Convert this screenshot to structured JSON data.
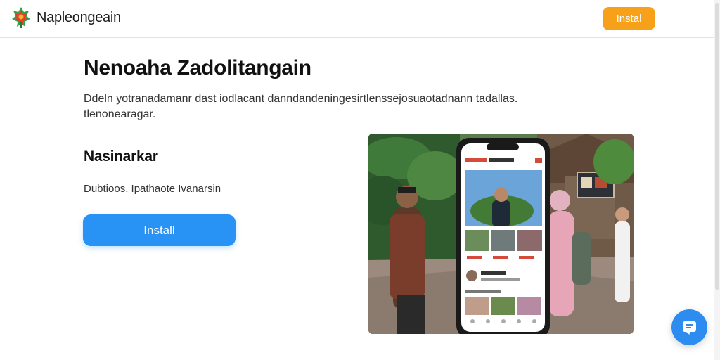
{
  "header": {
    "logo_icon": "maple-leaf-logo-icon",
    "brand_name": "Napleongeain",
    "install_label": "Instal",
    "install_color": "#f7a11a"
  },
  "hero": {
    "title": "Nenoaha Zadolitangain",
    "description": "Ddeln yotranadamanr dast iodlacant danndandeningesirtlenssejosuaotadnann tadallas. tlenonearagar.",
    "subtitle": "Nasinarkar",
    "subdescription": "Dubtioos, Ipathaote Ivanarsin",
    "install_label": "Install",
    "install_color": "#2892f5"
  },
  "preview": {
    "image_description_icon": "smartphone-app-preview-photo"
  },
  "chat": {
    "icon": "chat-bubble-icon",
    "color": "#2d8cf0"
  }
}
